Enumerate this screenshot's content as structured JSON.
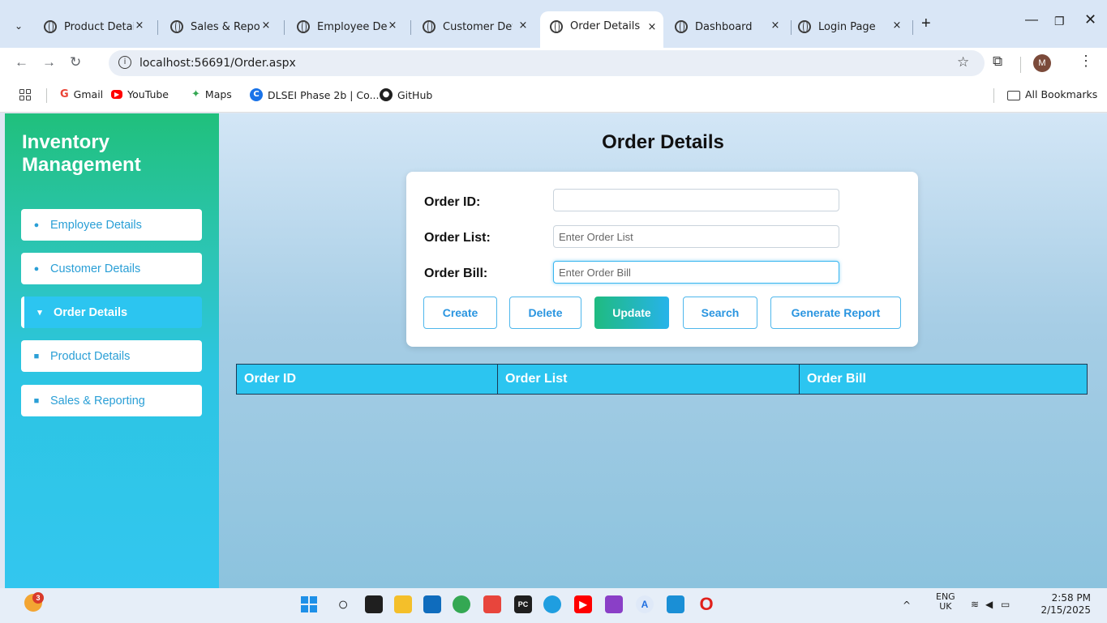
{
  "browser": {
    "tabs": [
      {
        "label": "Product Detail",
        "active": false
      },
      {
        "label": "Sales & Repor",
        "active": false
      },
      {
        "label": "Employee Det",
        "active": false
      },
      {
        "label": "Customer Det",
        "active": false
      },
      {
        "label": "Order Details",
        "active": true
      },
      {
        "label": "Dashboard",
        "active": false
      },
      {
        "label": "Login Page",
        "active": false
      }
    ],
    "close_glyph": "×",
    "new_tab_glyph": "+",
    "url": "localhost:56691/Order.aspx",
    "profile_initial": "M",
    "bookmarks": [
      {
        "icon": "gmail-icon",
        "label": "Gmail",
        "color": "#ea4335"
      },
      {
        "icon": "youtube-icon",
        "label": "YouTube",
        "color": "#ff0000"
      },
      {
        "icon": "maps-icon",
        "label": "Maps",
        "color": "#34a853"
      },
      {
        "icon": "dlsei-icon",
        "label": "DLSEI Phase 2b | Co...",
        "color": "#1a73e8"
      },
      {
        "icon": "github-icon",
        "label": "GitHub",
        "color": "#1f1f1f"
      }
    ],
    "all_bookmarks": "All Bookmarks"
  },
  "sidebar": {
    "brand": "Inventory Management",
    "items": [
      {
        "label": "Employee Details",
        "icon": "user-icon",
        "active": false
      },
      {
        "label": "Customer Details",
        "icon": "users-icon",
        "active": false
      },
      {
        "label": "Order Details",
        "icon": "cart-icon",
        "active": true
      },
      {
        "label": "Product Details",
        "icon": "box-icon",
        "active": false
      },
      {
        "label": "Sales & Reporting",
        "icon": "chart-icon",
        "active": false
      }
    ]
  },
  "main": {
    "title": "Order Details",
    "form": {
      "order_id": {
        "label": "Order ID:",
        "value": "",
        "placeholder": ""
      },
      "order_list": {
        "label": "Order List:",
        "value": "",
        "placeholder": "Enter Order List"
      },
      "order_bill": {
        "label": "Order Bill:",
        "value": "",
        "placeholder": "Enter Order Bill"
      }
    },
    "buttons": {
      "create": "Create",
      "delete": "Delete",
      "update": "Update",
      "search": "Search",
      "report": "Generate Report"
    },
    "table": {
      "columns": [
        "Order ID",
        "Order List",
        "Order Bill"
      ],
      "rows": []
    }
  },
  "taskbar": {
    "widget_badge": "3",
    "lang": "ENG",
    "region": "UK",
    "time": "2:58 PM",
    "date": "2/15/2025",
    "chevron": "^"
  },
  "colors": {
    "accent": "#2cc5f0",
    "sidebar_top": "#20c07c",
    "primary_button": "#27b3ea"
  }
}
